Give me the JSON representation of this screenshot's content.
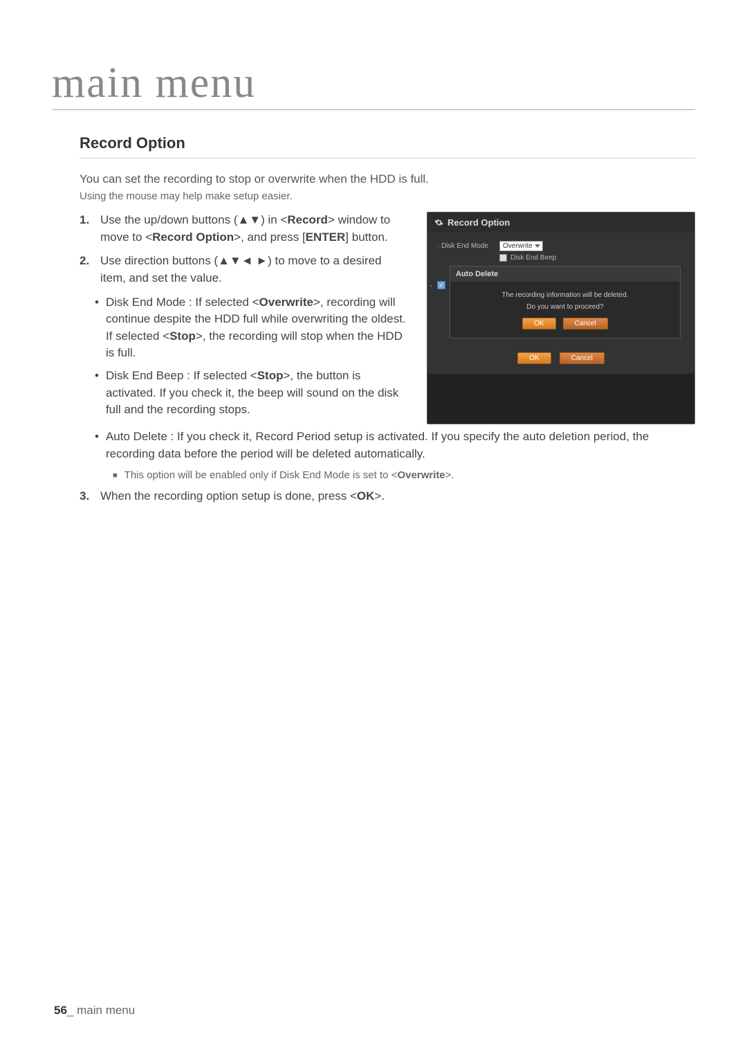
{
  "page": {
    "title": "main menu",
    "section_title": "Record Option",
    "intro": "You can set the recording to stop or overwrite when the HDD is full.",
    "intro_sub": "Using the mouse may help make setup easier.",
    "step1_pre": "Use the up/down buttons (▲▼) in <",
    "step1_bold1": "Record",
    "step1_mid": "> window to move to <",
    "step1_bold2": "Record Option",
    "step1_post": ">, and press [",
    "step1_bold3": "ENTER",
    "step1_end": "] button.",
    "step2": "Use direction buttons (▲▼◄ ►) to move to a desired item, and set the value.",
    "bullet1_pre": "Disk End Mode : If selected <",
    "bullet1_bold1": "Overwrite",
    "bullet1_mid": ">, recording will continue despite the HDD full while overwriting the oldest. If selected <",
    "bullet1_bold2": "Stop",
    "bullet1_post": ">, the recording will stop when the HDD is full.",
    "bullet2_pre": "Disk End Beep : If selected <",
    "bullet2_bold": "Stop",
    "bullet2_post": ">, the button is activated. If you check it, the beep will sound on the disk full and the recording stops.",
    "bullet3": "Auto Delete : If you check it, Record Period setup is activated. If you specify the auto deletion period, the recording data before the period will be deleted automatically.",
    "note_pre": "This option will be enabled only if Disk End Mode is set to <",
    "note_bold": "Overwrite",
    "note_post": ">.",
    "step3_pre": "When the recording option setup is done, press <",
    "step3_bold": "OK",
    "step3_post": ">.",
    "footer_num": "56",
    "footer_sep": "_",
    "footer_text": "main menu"
  },
  "ui": {
    "title": "Record Option",
    "disk_end_mode_label": "· Disk End Mode",
    "disk_end_mode_value": "Overwrite",
    "disk_end_beep_label": "Disk End Beep",
    "modal_title": "Auto Delete",
    "modal_line1": "The recording information will be deleted.",
    "modal_line2": "Do you want to proceed?",
    "ok_label": "OK",
    "cancel_label": "Cancel"
  }
}
